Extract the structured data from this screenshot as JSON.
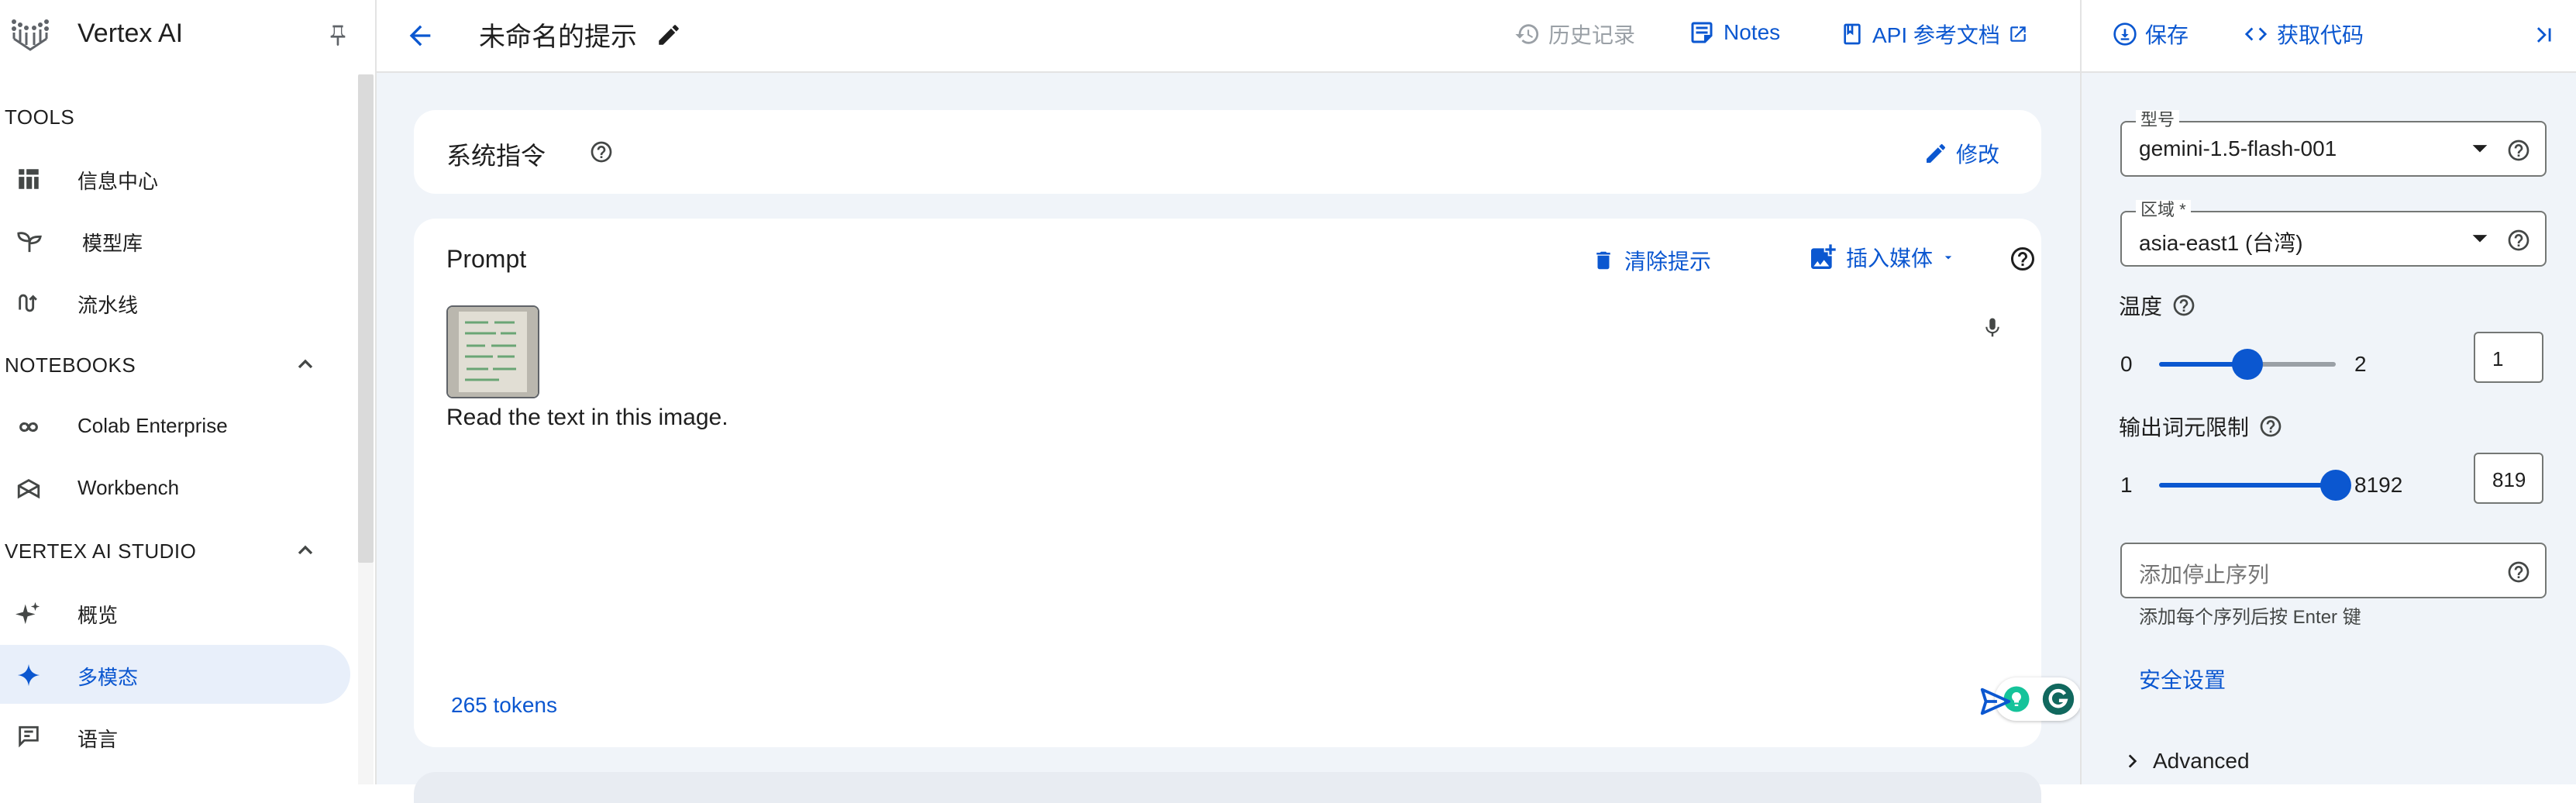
{
  "sidebar": {
    "app_title": "Vertex AI",
    "sections": [
      {
        "title": "TOOLS"
      },
      {
        "title": "NOTEBOOKS"
      },
      {
        "title": "VERTEX AI STUDIO"
      }
    ],
    "items": [
      {
        "label": "信息中心",
        "icon": "dashboard-icon"
      },
      {
        "label": "模型库",
        "icon": "model-garden-icon"
      },
      {
        "label": "流水线",
        "icon": "pipelines-icon"
      },
      {
        "label": "Colab Enterprise",
        "icon": "colab-icon"
      },
      {
        "label": "Workbench",
        "icon": "workbench-icon"
      },
      {
        "label": "概览",
        "icon": "overview-sparkle-icon"
      },
      {
        "label": "多模态",
        "icon": "multimodal-sparkle-icon",
        "active": true
      },
      {
        "label": "语言",
        "icon": "language-icon"
      }
    ]
  },
  "topbar": {
    "title": "未命名的提示",
    "history_label": "历史记录",
    "notes_label": "Notes",
    "api_docs_label": "API 参考文档"
  },
  "system_instructions": {
    "title": "系统指令",
    "edit_label": "修改"
  },
  "prompt": {
    "label": "Prompt",
    "clear_label": "清除提示",
    "insert_media_label": "插入媒体",
    "text": "Read the text in this image.",
    "token_count": "265 tokens"
  },
  "right_panel": {
    "save_label": "保存",
    "get_code_label": "获取代码",
    "model": {
      "label": "型号",
      "value": "gemini-1.5-flash-001"
    },
    "region": {
      "label": "区域 *",
      "value": "asia-east1 (台湾)"
    },
    "temperature": {
      "label": "温度",
      "min": "0",
      "max": "2",
      "value": "1",
      "fraction": 0.5
    },
    "output_limit": {
      "label": "输出词元限制",
      "min": "1",
      "max": "8192",
      "value": "819",
      "fraction": 1.0
    },
    "stop_sequence": {
      "placeholder": "添加停止序列",
      "hint": "添加每个序列后按 Enter 键"
    },
    "safety_label": "安全设置",
    "advanced_label": "Advanced"
  },
  "colors": {
    "accent": "#0b57d0",
    "background": "#f0f4f9",
    "active_nav": "#e8effa"
  }
}
